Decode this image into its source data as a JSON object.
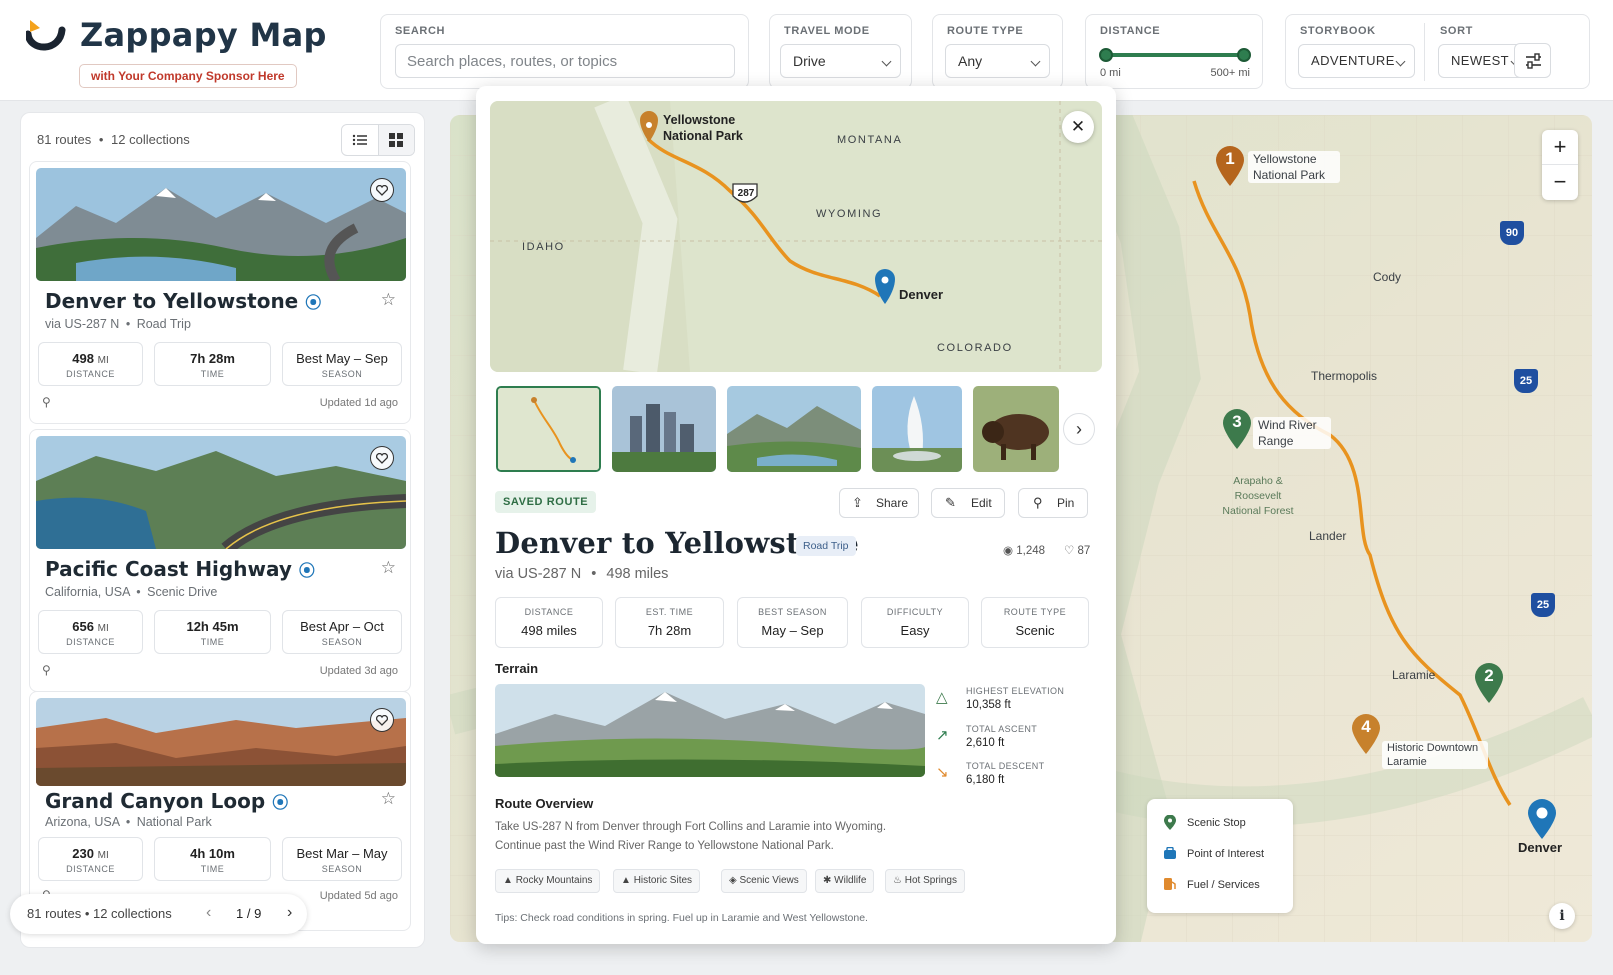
{
  "app": {
    "title": "Zappapy Map",
    "sponsor": "with Your Company Sponsor Here"
  },
  "filters": {
    "search": {
      "label": "SEARCH",
      "placeholder": "Search places, routes, or topics"
    },
    "travel_mode": {
      "label": "TRAVEL MODE",
      "value": "Drive"
    },
    "route_type": {
      "label": "ROUTE TYPE",
      "value": "Any"
    },
    "distance": {
      "label": "DISTANCE",
      "min": "0 mi",
      "max": "500+ mi",
      "low_fraction": 0.0,
      "high_fraction": 1.0
    },
    "storybook": {
      "label": "STORYBOOK",
      "value": "ADVENTURE"
    },
    "sort": {
      "label": "SORT",
      "value": "NEWEST"
    }
  },
  "sidebar": {
    "count_routes": "81 routes",
    "count_collections": "12 collections",
    "cards": [
      {
        "title": "Denver to Yellowstone",
        "sub1": "via US-287 N",
        "sub2": "Road Trip",
        "distance": "498",
        "distance_unit": "MI",
        "distance_label": "DISTANCE",
        "time": "7h 28m",
        "time_label": "TIME",
        "season": "Best May – Sep",
        "season_label": "SEASON",
        "updated": "Updated 1d ago"
      },
      {
        "title": "Pacific Coast Highway",
        "sub1": "California, USA",
        "sub2": "Scenic Drive",
        "distance": "656",
        "distance_unit": "MI",
        "distance_label": "DISTANCE",
        "time": "12h 45m",
        "time_label": "TIME",
        "season": "Best Apr – Oct",
        "season_label": "SEASON",
        "updated": "Updated 3d ago"
      },
      {
        "title": "Grand Canyon Loop",
        "sub1": "Arizona, USA",
        "sub2": "National Park",
        "distance": "230",
        "distance_unit": "MI",
        "distance_label": "DISTANCE",
        "time": "4h 10m",
        "time_label": "TIME",
        "season": "Best Mar – May",
        "season_label": "SEASON",
        "updated": "Updated 5d ago"
      }
    ],
    "pager": {
      "summary": "81 routes • 12 collections",
      "page": "1 / 9"
    }
  },
  "map": {
    "labels": {
      "cody": "Cody",
      "thermopolis": "Thermopolis",
      "lander": "Lander",
      "laramie": "Laramie",
      "forest": "Arapaho & Roosevelt National Forest"
    },
    "highways": [
      "90",
      "25",
      "25"
    ],
    "markers": [
      {
        "num": "1",
        "label": "Yellowstone National Park",
        "color": "#b5651d"
      },
      {
        "num": "2",
        "label": "",
        "color": "#3d7a4c"
      },
      {
        "num": "3",
        "label": "Wind River Range",
        "color": "#3d7a4c"
      },
      {
        "num": "4",
        "label": "Historic Downtown Laramie",
        "color": "#c7812c"
      },
      {
        "num": "",
        "label": "Denver",
        "color": "#1f76b8"
      }
    ],
    "legend": [
      {
        "label": "Scenic Stop",
        "icon": "pin-icon",
        "color": "#3d7a4c"
      },
      {
        "label": "Point of Interest",
        "icon": "bag-icon",
        "color": "#1f76b8"
      },
      {
        "label": "Fuel / Services",
        "icon": "fuel-icon",
        "color": "#e08a2e"
      }
    ],
    "zoom_in": "+",
    "zoom_out": "−",
    "info": "i"
  },
  "popup": {
    "mini_map": {
      "montana": "MONTANA",
      "wyoming": "WYOMING",
      "idaho": "IDAHO",
      "colorado": "COLORADO",
      "shield": "287",
      "start": "Yellowstone National Park",
      "end": "Denver"
    },
    "badge": "SAVED ROUTE",
    "actions": {
      "share": "Share",
      "edit": "Edit",
      "pin": "Pin"
    },
    "title": "Denver to Yellowstone",
    "tag": "Road Trip",
    "views": "1,248",
    "likes": "87",
    "via": "via US-287 N",
    "miles": "498 miles",
    "stats": [
      {
        "label": "DISTANCE",
        "value": "498 miles"
      },
      {
        "label": "EST. TIME",
        "value": "7h 28m"
      },
      {
        "label": "BEST SEASON",
        "value": "May – Sep"
      },
      {
        "label": "DIFFICULTY",
        "value": "Easy"
      },
      {
        "label": "ROUTE TYPE",
        "value": "Scenic"
      }
    ],
    "terrain_heading": "Terrain",
    "terrain_stats": [
      {
        "label": "HIGHEST ELEVATION",
        "value": "10,358 ft"
      },
      {
        "label": "TOTAL ASCENT",
        "value": "2,610 ft"
      },
      {
        "label": "TOTAL DESCENT",
        "value": "6,180 ft"
      }
    ],
    "overview_heading": "Route Overview",
    "overview_l1": "Take US-287 N from Denver through Fort Collins and Laramie into Wyoming.",
    "overview_l2": "Continue past the Wind River Range to Yellowstone National Park.",
    "chips": [
      "Rocky Mountains",
      "Historic Sites",
      "Scenic Views",
      "Wildlife",
      "Hot Springs"
    ],
    "tips": "Tips: Check road conditions in spring. Fuel up in Laramie and West Yellowstone."
  }
}
